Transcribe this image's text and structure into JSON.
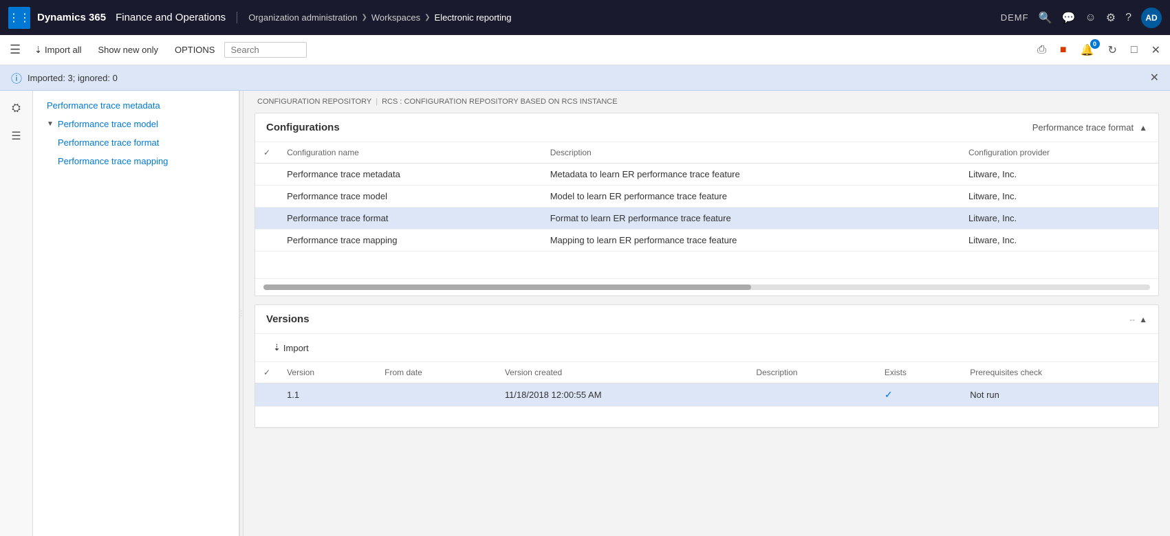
{
  "topNav": {
    "gridIcon": "⊞",
    "brand": "Dynamics 365",
    "app": "Finance and Operations",
    "breadcrumb": [
      {
        "label": "Organization administration"
      },
      {
        "label": "Workspaces"
      },
      {
        "label": "Electronic reporting",
        "active": true
      }
    ],
    "env": "DEMF",
    "icons": [
      "🔍",
      "💬",
      "😊",
      "⚙",
      "?"
    ],
    "avatar": "AD"
  },
  "actionBar": {
    "importLabel": "Import all",
    "showNewOnlyLabel": "Show new only",
    "optionsLabel": "OPTIONS"
  },
  "infoBanner": {
    "message": "Imported: 3; ignored: 0"
  },
  "treeNav": {
    "items": [
      {
        "label": "Performance trace metadata",
        "level": 1,
        "expanded": false
      },
      {
        "label": "Performance trace model",
        "level": 1,
        "expanded": true
      },
      {
        "label": "Performance trace format",
        "level": 2
      },
      {
        "label": "Performance trace mapping",
        "level": 2
      }
    ]
  },
  "pathBar": {
    "items": [
      "CONFIGURATION REPOSITORY",
      "RCS : CONFIGURATION REPOSITORY BASED ON RCS INSTANCE"
    ]
  },
  "configurationsPanel": {
    "title": "Configurations",
    "selectedConfig": "Performance trace format",
    "columns": {
      "check": "",
      "name": "Configuration name",
      "description": "Description",
      "provider": "Configuration provider"
    },
    "rows": [
      {
        "name": "Performance trace metadata",
        "description": "Metadata to learn ER performance trace feature",
        "provider": "Litware, Inc.",
        "selected": false
      },
      {
        "name": "Performance trace model",
        "description": "Model to learn ER performance trace feature",
        "provider": "Litware, Inc.",
        "selected": false
      },
      {
        "name": "Performance trace format",
        "description": "Format to learn ER performance trace feature",
        "provider": "Litware, Inc.",
        "selected": true
      },
      {
        "name": "Performance trace mapping",
        "description": "Mapping to learn ER performance trace feature",
        "provider": "Litware, Inc.",
        "selected": false
      }
    ]
  },
  "versionsPanel": {
    "title": "Versions",
    "importLabel": "Import",
    "dashLabel": "--",
    "columns": {
      "check": "",
      "version": "Version",
      "fromDate": "From date",
      "versionCreated": "Version created",
      "description": "Description",
      "exists": "Exists",
      "prerequisites": "Prerequisites check"
    },
    "rows": [
      {
        "version": "1.1",
        "fromDate": "",
        "versionCreated": "11/18/2018 12:00:55 AM",
        "description": "",
        "exists": true,
        "prerequisites": "Not run",
        "selected": true
      }
    ]
  }
}
